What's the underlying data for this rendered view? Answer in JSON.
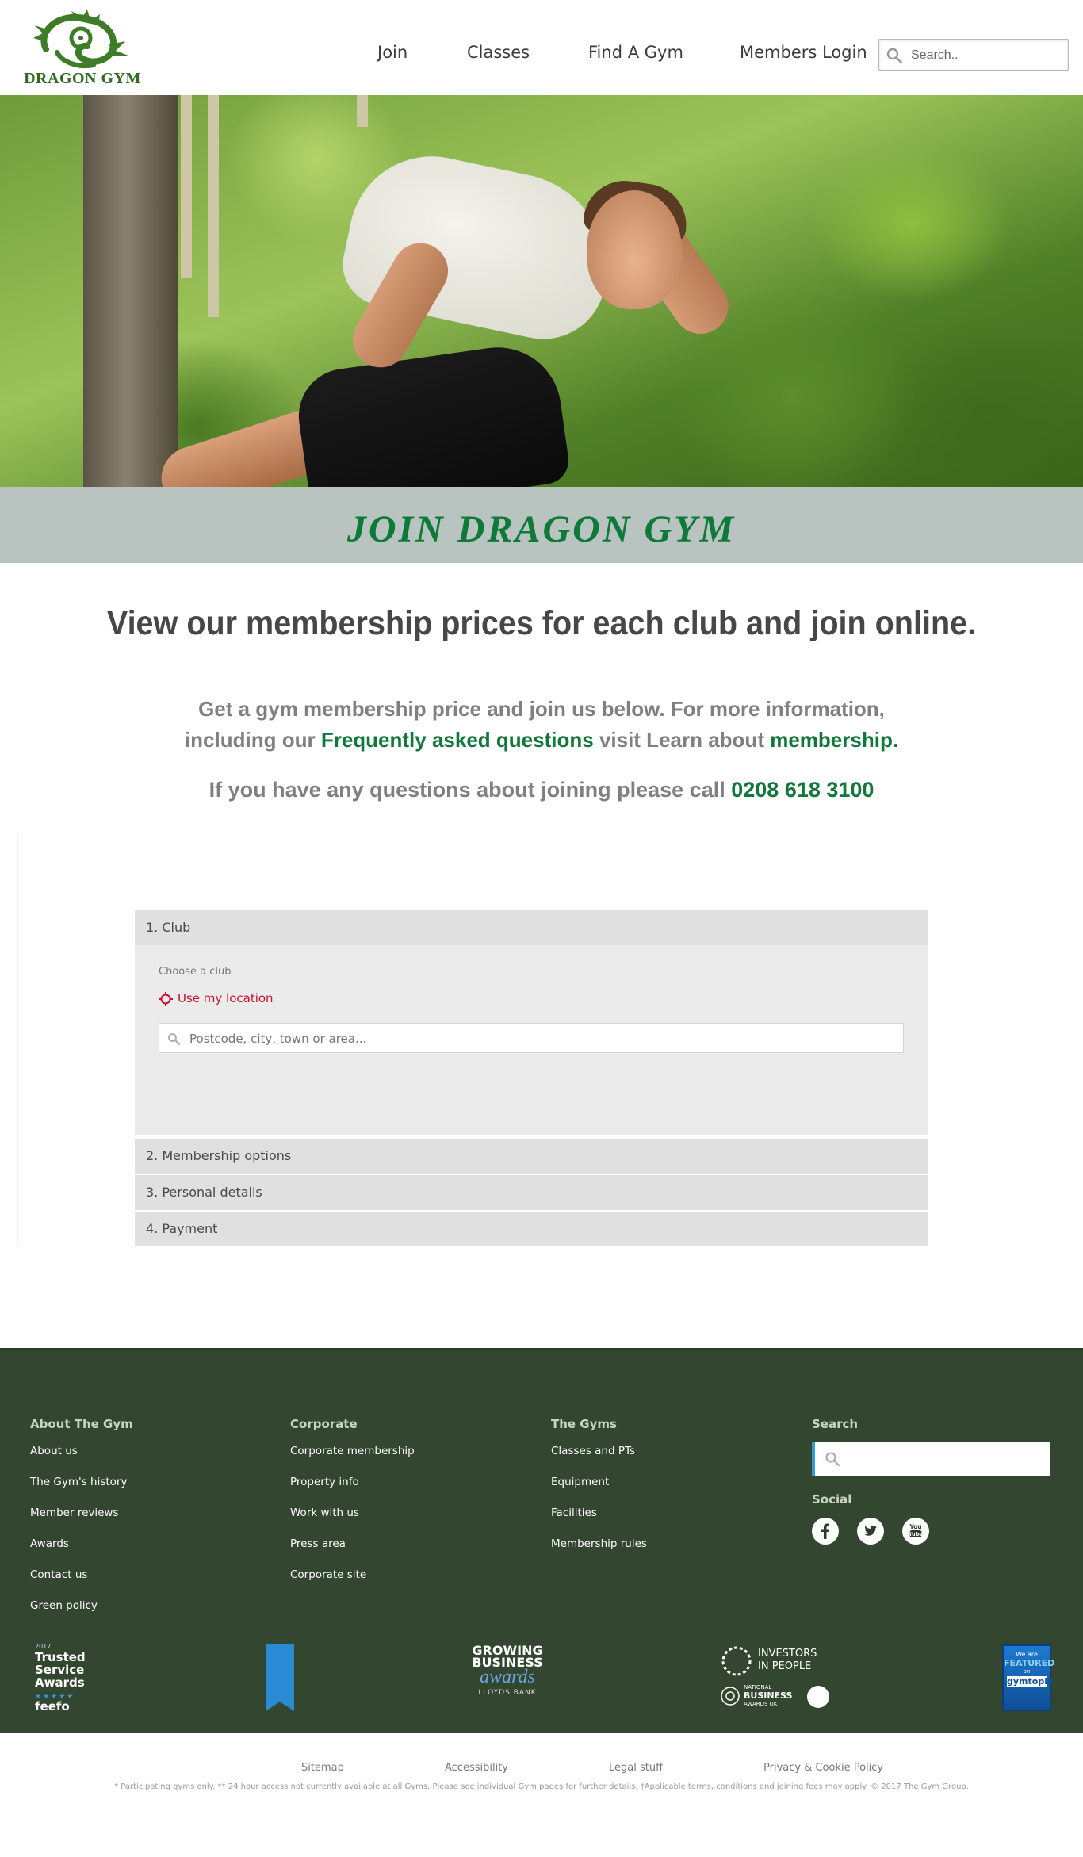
{
  "header": {
    "logo_text": "DRAGON GYM",
    "nav": [
      {
        "label": "Join"
      },
      {
        "label": "Classes"
      },
      {
        "label": "Find A Gym"
      },
      {
        "label": "Members Login"
      }
    ],
    "search_placeholder": "Search.."
  },
  "hero": {
    "banner_title": "JOIN DRAGON GYM"
  },
  "intro": {
    "headline": "View our membership prices for each club and join online.",
    "line1": "Get a gym membership price and join us below. For more information,",
    "line2_prefix": "including our",
    "faq_link": "Frequently asked questions",
    "line2_mid": "visit Learn about",
    "membership_link": "membership",
    "line2_suffix": ".",
    "phone_prefix": "If you have any questions about joining please call",
    "phone_number": "0208 618 3100"
  },
  "join_form": {
    "steps": [
      {
        "label": "1. Club"
      },
      {
        "label": "2. Membership options"
      },
      {
        "label": "3. Personal details"
      },
      {
        "label": "4. Payment"
      }
    ],
    "choose_label": "Choose a club",
    "use_location_label": "Use my location",
    "postcode_placeholder": "Postcode, city, town or area..."
  },
  "footer": {
    "columns": [
      {
        "title": "About The Gym",
        "links": [
          "About us",
          "The Gym's history",
          "Member reviews",
          "Awards",
          "Contact us",
          "Green policy"
        ]
      },
      {
        "title": "Corporate",
        "links": [
          "Corporate membership",
          "Property info",
          "Work with us",
          "Press area",
          "Corporate site"
        ]
      },
      {
        "title": "The Gyms",
        "links": [
          "Classes and PTs",
          "Equipment",
          "Facilities",
          "Membership rules"
        ]
      }
    ],
    "search_title": "Search",
    "social_title": "Social",
    "social": [
      "facebook-icon",
      "twitter-icon",
      "youtube-icon"
    ],
    "awards": {
      "feefo_year": "2017",
      "feefo_lines": [
        "Trusted",
        "Service",
        "Awards"
      ],
      "feefo_brand": "feefo",
      "growing_lines": [
        "GROWING",
        "BUSINESS"
      ],
      "growing_script": "awards",
      "growing_sponsor": "LLOYDS BANK",
      "iip_lines": [
        "INVESTORS",
        "IN PEOPLE"
      ],
      "nba_lines": [
        "NATIONAL",
        "BUSINESS",
        "AWARDS UK"
      ],
      "gymtopia_lines": [
        "We are",
        "FEATURED",
        "on",
        "gymtopia"
      ]
    }
  },
  "bottom": {
    "links": [
      "Sitemap",
      "Accessibility",
      "Legal stuff",
      "Privacy & Cookie Policy"
    ],
    "legal": "* Participating gyms only. ** 24 hour access not currently available at all Gyms. Please see individual Gym pages for further details. †Applicable terms, conditions and joining fees may apply. © 2017 The Gym Group."
  },
  "colors": {
    "brand_green": "#11773a",
    "footer_bg": "#334630",
    "banner_bg": "#b9c4c1",
    "location_red": "#c8102e",
    "search_accent": "#2e9bd6"
  }
}
